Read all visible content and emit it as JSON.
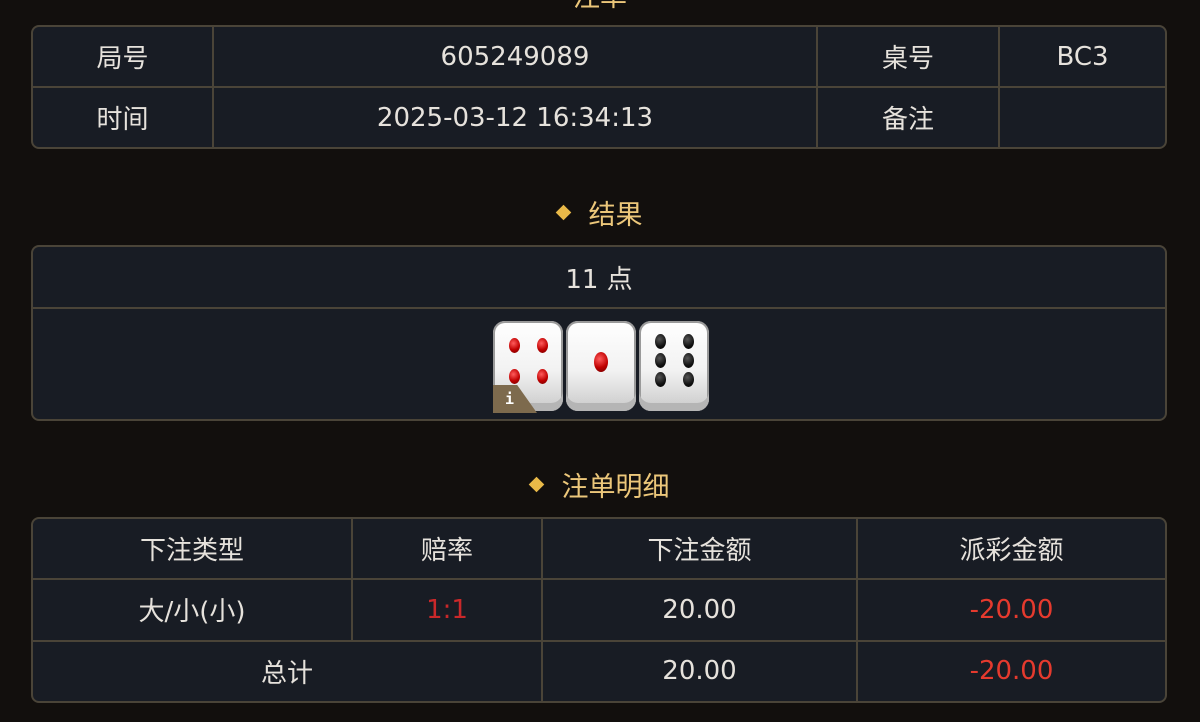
{
  "header": {
    "title": "注单"
  },
  "info_table": {
    "round_label": "局号",
    "round_value": "605249089",
    "table_label": "桌号",
    "table_value": "BC3",
    "time_label": "时间",
    "time_value": "2025-03-12 16:34:13",
    "remark_label": "备注",
    "remark_value": ""
  },
  "result": {
    "title": "结果",
    "points_text": "11 点",
    "dice": [
      4,
      1,
      6
    ],
    "info_badge": "i"
  },
  "details": {
    "title": "注单明细",
    "headers": [
      "下注类型",
      "赔率",
      "下注金额",
      "派彩金额"
    ],
    "rows": [
      {
        "bet_type": "大/小(小)",
        "odds": "1:1",
        "bet_amount": "20.00",
        "payout": "-20.00"
      }
    ],
    "total": {
      "label": "总计",
      "bet_amount": "20.00",
      "payout": "-20.00"
    },
    "colors": {
      "negative": "#e53a2e",
      "odds": "#c9282a"
    }
  },
  "colors": {
    "background": "#120f0d",
    "panel": "#181c24",
    "border": "#4a4438",
    "accent": "#ecc77a"
  }
}
